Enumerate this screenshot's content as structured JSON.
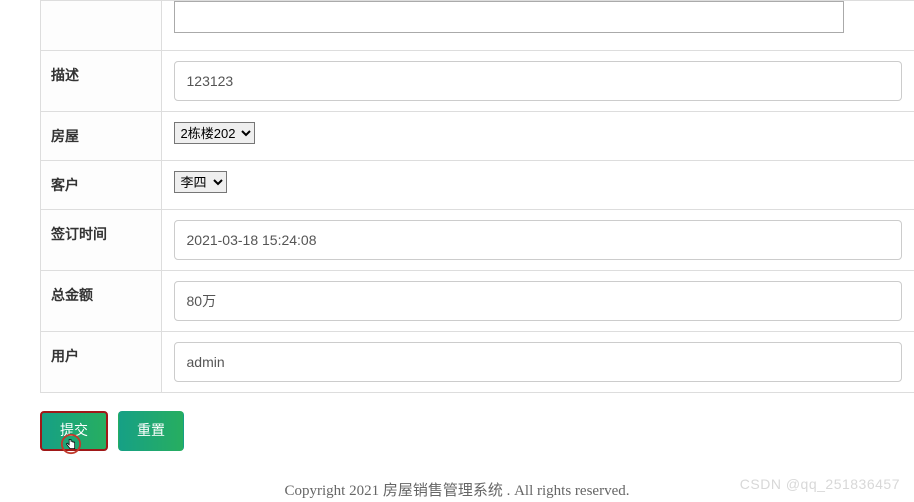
{
  "form": {
    "labels": {
      "description": "描述",
      "house": "房屋",
      "customer": "客户",
      "sign_time": "签订时间",
      "total_amount": "总金额",
      "user": "用户"
    },
    "values": {
      "description": "123123",
      "house_selected": "2栋楼202",
      "customer_selected": "李四",
      "sign_time": "2021-03-18 15:24:08",
      "total_amount": "80万",
      "user": "admin"
    }
  },
  "buttons": {
    "submit": "提交",
    "reset": "重置"
  },
  "footer": "Copyright 2021 房屋销售管理系统 . All rights reserved.",
  "watermark": "CSDN @qq_251836457"
}
